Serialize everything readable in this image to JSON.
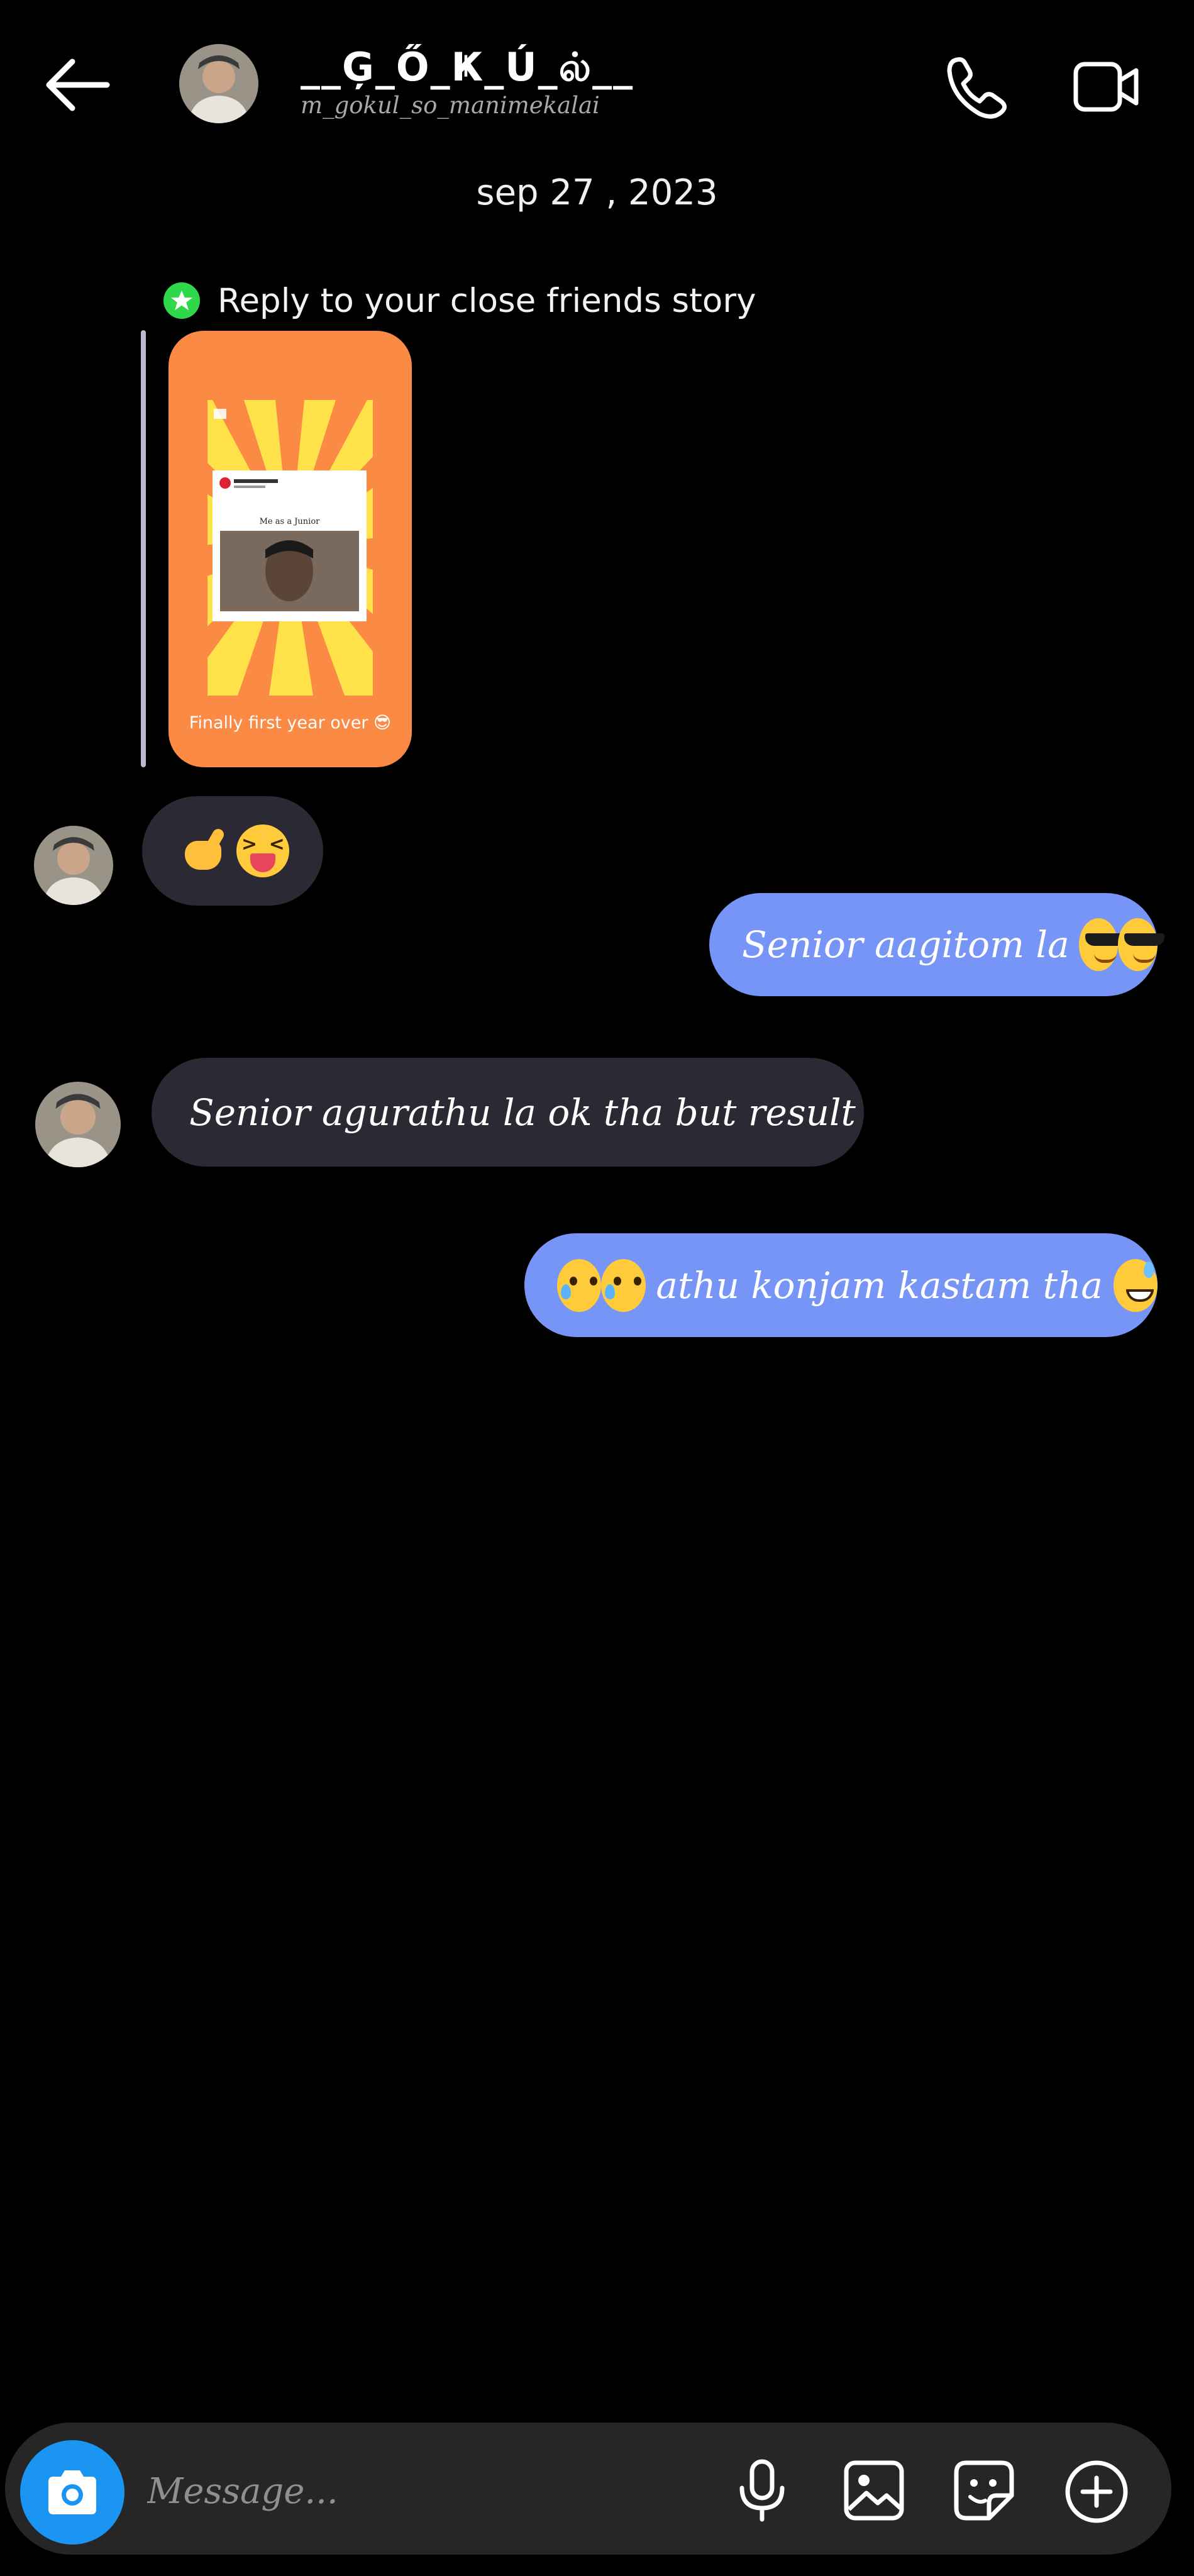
{
  "header": {
    "title": "__Ģ_Ő_Ҝ_Ú_ல்__",
    "handle": "m_gokul_so_manimekalai",
    "back_icon": "arrow-left-icon",
    "call_icon": "phone-icon",
    "video_icon": "video-camera-icon"
  },
  "conversation": {
    "date": "sep 27 , 2023",
    "story_reply": {
      "label": "Reply to your close friends story",
      "badge_icon": "close-friends-star-icon",
      "story_caption": "Finally first year over 😎",
      "story_card_title": "Me as a Junior"
    },
    "messages": [
      {
        "direction": "incoming",
        "text": "",
        "emojis": [
          "call-me-hand",
          "squinting-tongue"
        ]
      },
      {
        "direction": "outgoing",
        "text": "Senior aagitom la",
        "emojis": [
          "sunglasses-face",
          "sunglasses-face"
        ]
      },
      {
        "direction": "incoming",
        "text": "Senior agurathu la ok tha but result"
      },
      {
        "direction": "outgoing",
        "text": "athu konjam kastam tha",
        "emojis_before": [
          "smiling-tear-face",
          "smiling-tear-face"
        ],
        "emojis_after": [
          "grinning-sweat-face"
        ]
      }
    ]
  },
  "composer": {
    "placeholder": "Message...",
    "camera_icon": "camera-icon",
    "mic_icon": "microphone-icon",
    "gallery_icon": "image-icon",
    "sticker_icon": "sticker-icon",
    "plus_icon": "plus-circle-icon"
  },
  "colors": {
    "background": "#000000",
    "incoming_bubble": "#2b2a34",
    "outgoing_bubble": "#7795f7",
    "close_friends_green": "#2fd84b",
    "camera_button": "#1a96f2",
    "story_background": "#fb8a45"
  }
}
